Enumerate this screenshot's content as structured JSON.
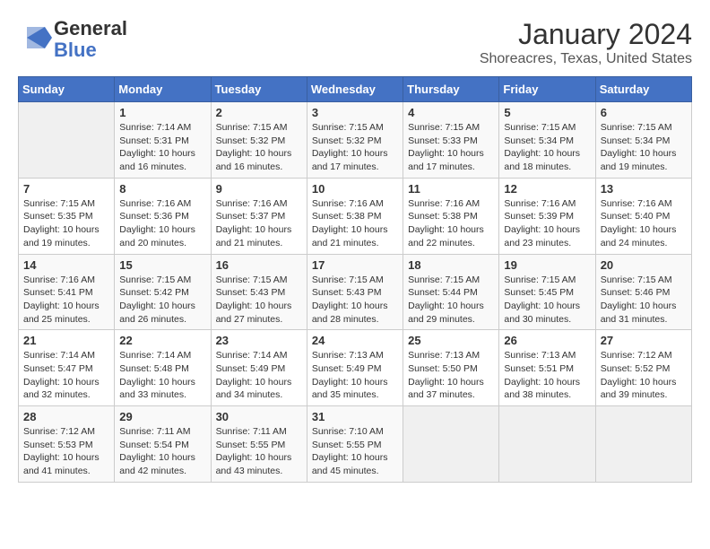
{
  "logo": {
    "line1": "General",
    "line2": "Blue"
  },
  "title": "January 2024",
  "subtitle": "Shoreacres, Texas, United States",
  "headers": [
    "Sunday",
    "Monday",
    "Tuesday",
    "Wednesday",
    "Thursday",
    "Friday",
    "Saturday"
  ],
  "weeks": [
    [
      {
        "day": "",
        "sunrise": "",
        "sunset": "",
        "daylight": ""
      },
      {
        "day": "1",
        "sunrise": "Sunrise: 7:14 AM",
        "sunset": "Sunset: 5:31 PM",
        "daylight": "Daylight: 10 hours and 16 minutes."
      },
      {
        "day": "2",
        "sunrise": "Sunrise: 7:15 AM",
        "sunset": "Sunset: 5:32 PM",
        "daylight": "Daylight: 10 hours and 16 minutes."
      },
      {
        "day": "3",
        "sunrise": "Sunrise: 7:15 AM",
        "sunset": "Sunset: 5:32 PM",
        "daylight": "Daylight: 10 hours and 17 minutes."
      },
      {
        "day": "4",
        "sunrise": "Sunrise: 7:15 AM",
        "sunset": "Sunset: 5:33 PM",
        "daylight": "Daylight: 10 hours and 17 minutes."
      },
      {
        "day": "5",
        "sunrise": "Sunrise: 7:15 AM",
        "sunset": "Sunset: 5:34 PM",
        "daylight": "Daylight: 10 hours and 18 minutes."
      },
      {
        "day": "6",
        "sunrise": "Sunrise: 7:15 AM",
        "sunset": "Sunset: 5:34 PM",
        "daylight": "Daylight: 10 hours and 19 minutes."
      }
    ],
    [
      {
        "day": "7",
        "sunrise": "Sunrise: 7:15 AM",
        "sunset": "Sunset: 5:35 PM",
        "daylight": "Daylight: 10 hours and 19 minutes."
      },
      {
        "day": "8",
        "sunrise": "Sunrise: 7:16 AM",
        "sunset": "Sunset: 5:36 PM",
        "daylight": "Daylight: 10 hours and 20 minutes."
      },
      {
        "day": "9",
        "sunrise": "Sunrise: 7:16 AM",
        "sunset": "Sunset: 5:37 PM",
        "daylight": "Daylight: 10 hours and 21 minutes."
      },
      {
        "day": "10",
        "sunrise": "Sunrise: 7:16 AM",
        "sunset": "Sunset: 5:38 PM",
        "daylight": "Daylight: 10 hours and 21 minutes."
      },
      {
        "day": "11",
        "sunrise": "Sunrise: 7:16 AM",
        "sunset": "Sunset: 5:38 PM",
        "daylight": "Daylight: 10 hours and 22 minutes."
      },
      {
        "day": "12",
        "sunrise": "Sunrise: 7:16 AM",
        "sunset": "Sunset: 5:39 PM",
        "daylight": "Daylight: 10 hours and 23 minutes."
      },
      {
        "day": "13",
        "sunrise": "Sunrise: 7:16 AM",
        "sunset": "Sunset: 5:40 PM",
        "daylight": "Daylight: 10 hours and 24 minutes."
      }
    ],
    [
      {
        "day": "14",
        "sunrise": "Sunrise: 7:16 AM",
        "sunset": "Sunset: 5:41 PM",
        "daylight": "Daylight: 10 hours and 25 minutes."
      },
      {
        "day": "15",
        "sunrise": "Sunrise: 7:15 AM",
        "sunset": "Sunset: 5:42 PM",
        "daylight": "Daylight: 10 hours and 26 minutes."
      },
      {
        "day": "16",
        "sunrise": "Sunrise: 7:15 AM",
        "sunset": "Sunset: 5:43 PM",
        "daylight": "Daylight: 10 hours and 27 minutes."
      },
      {
        "day": "17",
        "sunrise": "Sunrise: 7:15 AM",
        "sunset": "Sunset: 5:43 PM",
        "daylight": "Daylight: 10 hours and 28 minutes."
      },
      {
        "day": "18",
        "sunrise": "Sunrise: 7:15 AM",
        "sunset": "Sunset: 5:44 PM",
        "daylight": "Daylight: 10 hours and 29 minutes."
      },
      {
        "day": "19",
        "sunrise": "Sunrise: 7:15 AM",
        "sunset": "Sunset: 5:45 PM",
        "daylight": "Daylight: 10 hours and 30 minutes."
      },
      {
        "day": "20",
        "sunrise": "Sunrise: 7:15 AM",
        "sunset": "Sunset: 5:46 PM",
        "daylight": "Daylight: 10 hours and 31 minutes."
      }
    ],
    [
      {
        "day": "21",
        "sunrise": "Sunrise: 7:14 AM",
        "sunset": "Sunset: 5:47 PM",
        "daylight": "Daylight: 10 hours and 32 minutes."
      },
      {
        "day": "22",
        "sunrise": "Sunrise: 7:14 AM",
        "sunset": "Sunset: 5:48 PM",
        "daylight": "Daylight: 10 hours and 33 minutes."
      },
      {
        "day": "23",
        "sunrise": "Sunrise: 7:14 AM",
        "sunset": "Sunset: 5:49 PM",
        "daylight": "Daylight: 10 hours and 34 minutes."
      },
      {
        "day": "24",
        "sunrise": "Sunrise: 7:13 AM",
        "sunset": "Sunset: 5:49 PM",
        "daylight": "Daylight: 10 hours and 35 minutes."
      },
      {
        "day": "25",
        "sunrise": "Sunrise: 7:13 AM",
        "sunset": "Sunset: 5:50 PM",
        "daylight": "Daylight: 10 hours and 37 minutes."
      },
      {
        "day": "26",
        "sunrise": "Sunrise: 7:13 AM",
        "sunset": "Sunset: 5:51 PM",
        "daylight": "Daylight: 10 hours and 38 minutes."
      },
      {
        "day": "27",
        "sunrise": "Sunrise: 7:12 AM",
        "sunset": "Sunset: 5:52 PM",
        "daylight": "Daylight: 10 hours and 39 minutes."
      }
    ],
    [
      {
        "day": "28",
        "sunrise": "Sunrise: 7:12 AM",
        "sunset": "Sunset: 5:53 PM",
        "daylight": "Daylight: 10 hours and 41 minutes."
      },
      {
        "day": "29",
        "sunrise": "Sunrise: 7:11 AM",
        "sunset": "Sunset: 5:54 PM",
        "daylight": "Daylight: 10 hours and 42 minutes."
      },
      {
        "day": "30",
        "sunrise": "Sunrise: 7:11 AM",
        "sunset": "Sunset: 5:55 PM",
        "daylight": "Daylight: 10 hours and 43 minutes."
      },
      {
        "day": "31",
        "sunrise": "Sunrise: 7:10 AM",
        "sunset": "Sunset: 5:55 PM",
        "daylight": "Daylight: 10 hours and 45 minutes."
      },
      {
        "day": "",
        "sunrise": "",
        "sunset": "",
        "daylight": ""
      },
      {
        "day": "",
        "sunrise": "",
        "sunset": "",
        "daylight": ""
      },
      {
        "day": "",
        "sunrise": "",
        "sunset": "",
        "daylight": ""
      }
    ]
  ]
}
